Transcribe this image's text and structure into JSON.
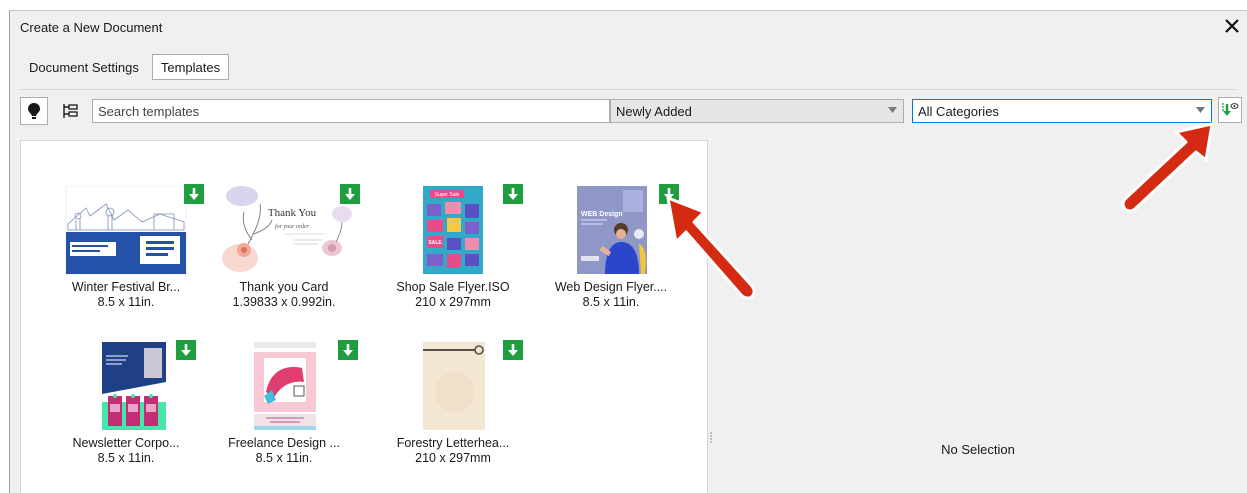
{
  "dialog": {
    "title": "Create a New Document",
    "close_icon": "close-icon"
  },
  "tabs": [
    {
      "label": "Document Settings",
      "active": false
    },
    {
      "label": "Templates",
      "active": true
    }
  ],
  "toolbar": {
    "pin_icon": "lightbulb-icon",
    "tree_icon": "tree-view-icon",
    "search_placeholder": "Search templates",
    "sort_selected": "Newly Added",
    "category_selected": "All Categories",
    "download_filter_icon": "download-view-icon"
  },
  "templates": [
    {
      "name": "Winter Festival Br...",
      "size": "8.5 x 11in."
    },
    {
      "name": "Thank you Card",
      "size": "1.39833 x 0.992in."
    },
    {
      "name": "Shop Sale Flyer.ISO",
      "size": "210 x 297mm"
    },
    {
      "name": "Web Design Flyer....",
      "size": "8.5 x 11in."
    },
    {
      "name": "Newsletter Corpo...",
      "size": "8.5 x 11in."
    },
    {
      "name": "Freelance Design ...",
      "size": "8.5 x 11in."
    },
    {
      "name": "Forestry Letterhea...",
      "size": "210 x 297mm"
    }
  ],
  "thumb_texts": {
    "thank_you": "Thank You",
    "for_order": "for your order",
    "super_sale": "Super Sale",
    "sale": "SALE",
    "web_design": "WEB Design"
  },
  "detail": {
    "status": "No Selection"
  },
  "colors": {
    "download_badge": "#1e9e3e",
    "annotation_arrow": "#d42a12",
    "focus_border": "#0078d7"
  }
}
